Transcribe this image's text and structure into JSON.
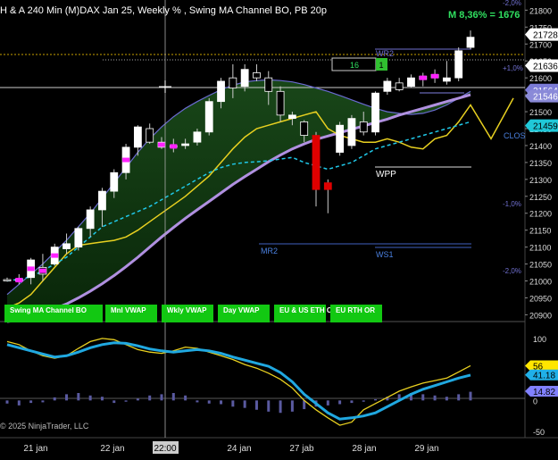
{
  "header": {
    "title": "H & A 240 Min (M)DAX Jan 25, Weekly % , Swing MA Channel BO, PB 20p",
    "stat": "M 8,36% = 1676"
  },
  "copyright": "© 2025 NinjaTrader, LLC",
  "position_box": {
    "qty": "16",
    "side": "1"
  },
  "buttons": [
    "Swing MA Channel BO",
    "Mnl VWAP",
    "Wkly VWAP",
    "Day VWAP",
    "EU & US ETH OR",
    "EU RTH OR"
  ],
  "levels": {
    "WR2": "WR2",
    "WPP": "WPP",
    "MR2": "MR2",
    "WS1": "WS1",
    "CLOS": "CLOS",
    "pct_plus_2": "-2,0%",
    "pct_plus_1": "+1,0%",
    "pct_minus_1": "-1,0%",
    "pct_minus_2": "-2,0%"
  },
  "price_tags": [
    {
      "text": "21728",
      "bg": "#ffffff",
      "fg": "#000000",
      "value": 21728
    },
    {
      "text": "21636",
      "bg": "#ffffff",
      "fg": "#000000",
      "value": 21636
    },
    {
      "text": "21564",
      "bg": "#7b7bd6",
      "fg": "#ffffff",
      "value": 21564
    },
    {
      "text": "21546",
      "bg": "#8a8ad8",
      "fg": "#ffffff",
      "value": 21546
    },
    {
      "text": "21459",
      "bg": "#20c8d8",
      "fg": "#000000",
      "value": 21459
    }
  ],
  "osc_tags": [
    {
      "text": "56",
      "bg": "#ffe600",
      "fg": "#000000",
      "value": 56
    },
    {
      "text": "41.18",
      "bg": "#20b0e8",
      "fg": "#000000",
      "value": 41.18
    },
    {
      "text": "14.82",
      "bg": "#8080ff",
      "fg": "#000000",
      "value": 14.82
    }
  ],
  "time_cursor": "22:00",
  "chart_data": {
    "type": "candlestick",
    "x_ticks": [
      "21 jan",
      "22 jan",
      "24 jan",
      "27 jab",
      "28 jan",
      "29 jan"
    ],
    "y_ticks": [
      21800,
      21750,
      21700,
      21650,
      21600,
      21550,
      21500,
      21450,
      21400,
      21350,
      21300,
      21250,
      21200,
      21150,
      21100,
      21050,
      21000,
      20950,
      20900
    ],
    "ylim": [
      20880,
      21830
    ],
    "osc_ticks": [
      100,
      50,
      0,
      -50
    ],
    "osc_ylim": [
      -60,
      120
    ],
    "candles": [
      {
        "o": 21004,
        "h": 21010,
        "l": 20998,
        "c": 21003
      },
      {
        "o": 21000,
        "h": 21020,
        "l": 20990,
        "c": 21005
      },
      {
        "o": 21010,
        "h": 21068,
        "l": 20990,
        "c": 21062
      },
      {
        "o": 21040,
        "h": 21080,
        "l": 21000,
        "c": 21020
      },
      {
        "o": 21050,
        "h": 21110,
        "l": 21045,
        "c": 21100
      },
      {
        "o": 21095,
        "h": 21140,
        "l": 21080,
        "c": 21110
      },
      {
        "o": 21100,
        "h": 21160,
        "l": 21090,
        "c": 21155
      },
      {
        "o": 21155,
        "h": 21220,
        "l": 21130,
        "c": 21210
      },
      {
        "o": 21210,
        "h": 21275,
        "l": 21160,
        "c": 21265
      },
      {
        "o": 21265,
        "h": 21330,
        "l": 21245,
        "c": 21320
      },
      {
        "o": 21320,
        "h": 21405,
        "l": 21300,
        "c": 21395
      },
      {
        "o": 21395,
        "h": 21460,
        "l": 21370,
        "c": 21455
      },
      {
        "o": 21450,
        "h": 21465,
        "l": 21405,
        "c": 21410
      },
      {
        "o": 21410,
        "h": 21425,
        "l": 21390,
        "c": 21395
      },
      {
        "o": 21395,
        "h": 21420,
        "l": 21380,
        "c": 21400
      },
      {
        "o": 21400,
        "h": 21420,
        "l": 21390,
        "c": 21405
      },
      {
        "o": 21410,
        "h": 21450,
        "l": 21400,
        "c": 21440
      },
      {
        "o": 21440,
        "h": 21540,
        "l": 21430,
        "c": 21530
      },
      {
        "o": 21530,
        "h": 21600,
        "l": 21510,
        "c": 21590
      },
      {
        "o": 21600,
        "h": 21640,
        "l": 21540,
        "c": 21570
      },
      {
        "o": 21575,
        "h": 21640,
        "l": 21560,
        "c": 21625
      },
      {
        "o": 21615,
        "h": 21640,
        "l": 21590,
        "c": 21600
      },
      {
        "o": 21600,
        "h": 21620,
        "l": 21520,
        "c": 21560
      },
      {
        "o": 21560,
        "h": 21575,
        "l": 21470,
        "c": 21490
      },
      {
        "o": 21480,
        "h": 21500,
        "l": 21460,
        "c": 21490
      },
      {
        "o": 21470,
        "h": 21475,
        "l": 21410,
        "c": 21430
      },
      {
        "o": 21430,
        "h": 21440,
        "l": 21220,
        "c": 21270
      },
      {
        "o": 21270,
        "h": 21300,
        "l": 21200,
        "c": 21290
      },
      {
        "o": 21380,
        "h": 21470,
        "l": 21370,
        "c": 21460
      },
      {
        "o": 21400,
        "h": 21490,
        "l": 21390,
        "c": 21480
      },
      {
        "o": 21470,
        "h": 21500,
        "l": 21430,
        "c": 21440
      },
      {
        "o": 21440,
        "h": 21560,
        "l": 21430,
        "c": 21555
      },
      {
        "o": 21560,
        "h": 21600,
        "l": 21550,
        "c": 21590
      },
      {
        "o": 21585,
        "h": 21600,
        "l": 21560,
        "c": 21565
      },
      {
        "o": 21575,
        "h": 21610,
        "l": 21570,
        "c": 21600
      },
      {
        "o": 21595,
        "h": 21615,
        "l": 21575,
        "c": 21605
      },
      {
        "o": 21600,
        "h": 21625,
        "l": 21585,
        "c": 21610
      },
      {
        "o": 21590,
        "h": 21650,
        "l": 21580,
        "c": 21600
      },
      {
        "o": 21600,
        "h": 21690,
        "l": 21590,
        "c": 21680
      },
      {
        "o": 21690,
        "h": 21740,
        "l": 21685,
        "c": 21720
      }
    ]
  }
}
